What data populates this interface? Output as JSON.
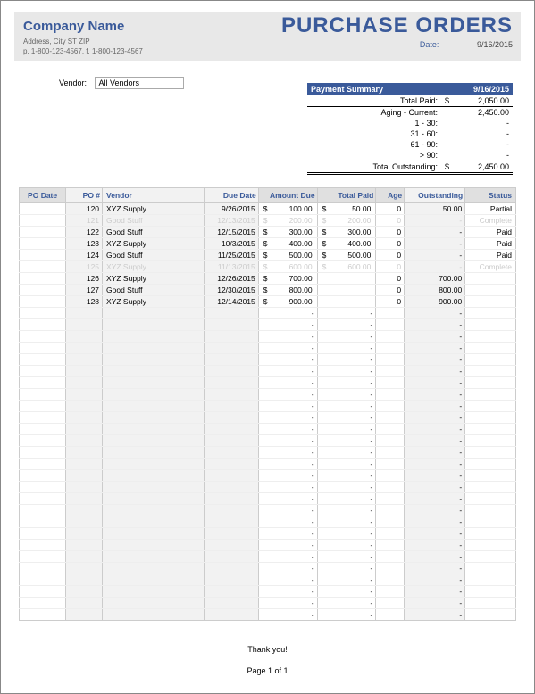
{
  "header": {
    "company": "Company Name",
    "address": "Address, City ST ZIP",
    "phone": "p. 1-800-123-4567, f. 1-800-123-4567",
    "title": "PURCHASE ORDERS",
    "date_label": "Date:",
    "date_value": "9/16/2015"
  },
  "filter": {
    "vendor_label": "Vendor:",
    "vendor_value": "All Vendors"
  },
  "summary": {
    "title": "Payment Summary",
    "date": "9/16/2015",
    "rows": [
      {
        "label": "Total Paid:",
        "cur": "$",
        "value": "2,050.00",
        "cls": "underline"
      },
      {
        "label": "Aging - Current:",
        "cur": "",
        "value": "2,450.00",
        "cls": ""
      },
      {
        "label": "1 - 30:",
        "cur": "",
        "value": "-",
        "cls": ""
      },
      {
        "label": "31 - 60:",
        "cur": "",
        "value": "-",
        "cls": ""
      },
      {
        "label": "61 - 90:",
        "cur": "",
        "value": "-",
        "cls": ""
      },
      {
        "label": "> 90:",
        "cur": "",
        "value": "-",
        "cls": "underline"
      },
      {
        "label": "Total Outstanding:",
        "cur": "$",
        "value": "2,450.00",
        "cls": "dbl"
      }
    ]
  },
  "columns": {
    "podate": "PO Date",
    "ponum": "PO #",
    "vendor": "Vendor",
    "due": "Due Date",
    "amtdue": "Amount Due",
    "paid": "Total Paid",
    "age": "Age",
    "out": "Outstanding",
    "status": "Status"
  },
  "rows": [
    {
      "podate": "",
      "ponum": "120",
      "vendor": "XYZ Supply",
      "due": "9/26/2015",
      "amtdue": "100.00",
      "paid": "50.00",
      "age": "0",
      "out": "50.00",
      "status": "Partial",
      "ghost": false
    },
    {
      "podate": "",
      "ponum": "121",
      "vendor": "Good Stuff",
      "due": "12/13/2015",
      "amtdue": "200.00",
      "paid": "200.00",
      "age": "0",
      "out": "-",
      "status": "Complete",
      "ghost": true
    },
    {
      "podate": "",
      "ponum": "122",
      "vendor": "Good Stuff",
      "due": "12/15/2015",
      "amtdue": "300.00",
      "paid": "300.00",
      "age": "0",
      "out": "-",
      "status": "Paid",
      "ghost": false
    },
    {
      "podate": "",
      "ponum": "123",
      "vendor": "XYZ Supply",
      "due": "10/3/2015",
      "amtdue": "400.00",
      "paid": "400.00",
      "age": "0",
      "out": "-",
      "status": "Paid",
      "ghost": false
    },
    {
      "podate": "",
      "ponum": "124",
      "vendor": "Good Stuff",
      "due": "11/25/2015",
      "amtdue": "500.00",
      "paid": "500.00",
      "age": "0",
      "out": "-",
      "status": "Paid",
      "ghost": false
    },
    {
      "podate": "",
      "ponum": "125",
      "vendor": "XYZ Supply",
      "due": "11/13/2015",
      "amtdue": "600.00",
      "paid": "600.00",
      "age": "0",
      "out": "-",
      "status": "Complete",
      "ghost": true
    },
    {
      "podate": "",
      "ponum": "126",
      "vendor": "XYZ Supply",
      "due": "12/26/2015",
      "amtdue": "700.00",
      "paid": "",
      "age": "0",
      "out": "700.00",
      "status": "",
      "ghost": false
    },
    {
      "podate": "",
      "ponum": "127",
      "vendor": "Good Stuff",
      "due": "12/30/2015",
      "amtdue": "800.00",
      "paid": "",
      "age": "0",
      "out": "800.00",
      "status": "",
      "ghost": false
    },
    {
      "podate": "",
      "ponum": "128",
      "vendor": "XYZ Supply",
      "due": "12/14/2015",
      "amtdue": "900.00",
      "paid": "",
      "age": "0",
      "out": "900.00",
      "status": "",
      "ghost": false
    }
  ],
  "blank_rows": 27,
  "footer": {
    "thank": "Thank you!",
    "page": "Page 1 of 1"
  }
}
